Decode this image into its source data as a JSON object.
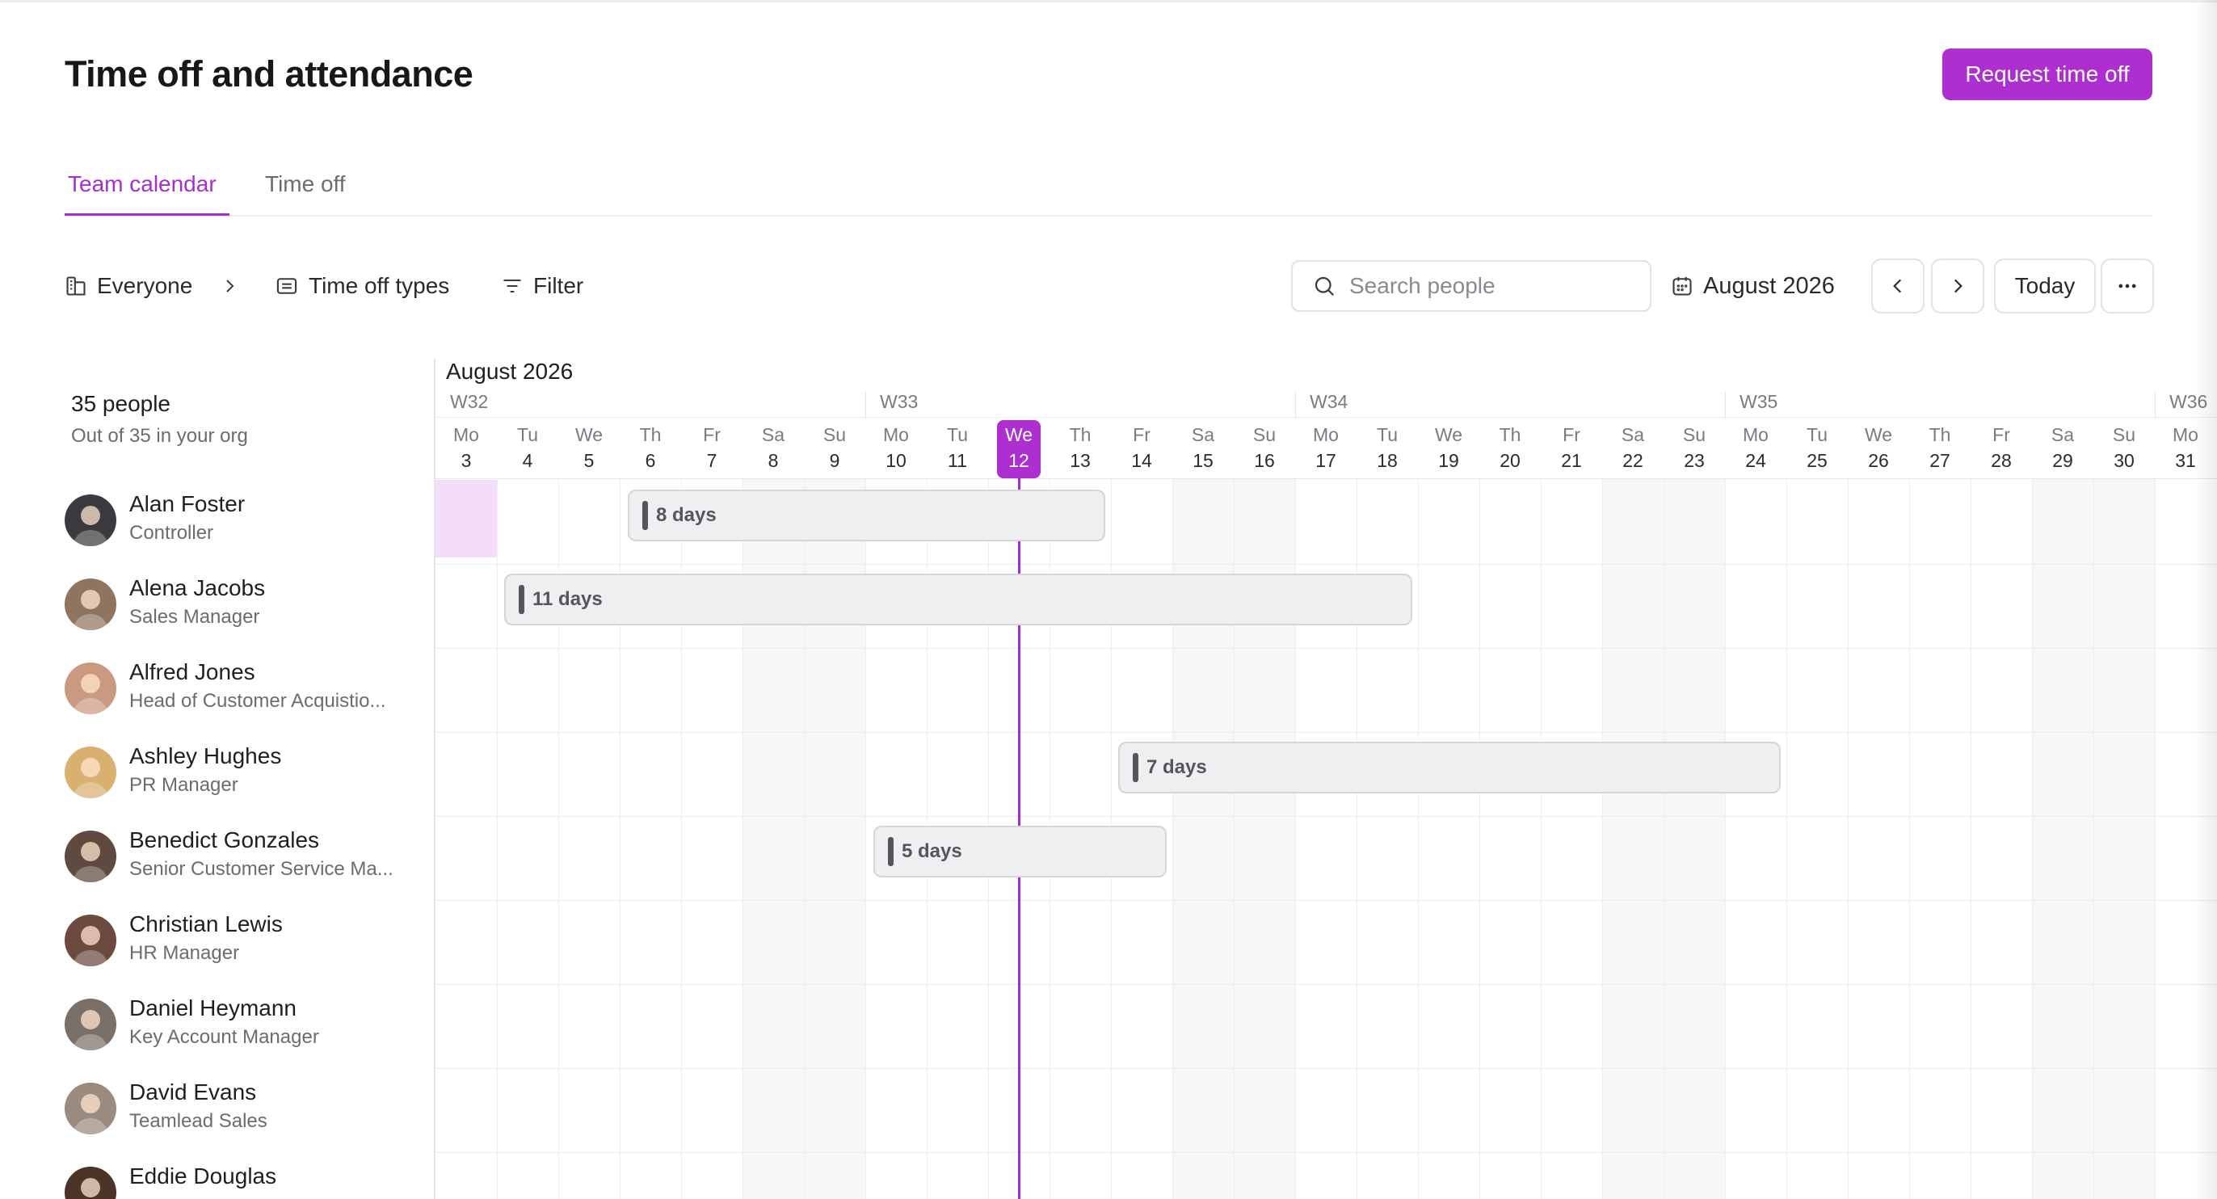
{
  "header": {
    "title": "Time off and attendance",
    "request_button": "Request time off"
  },
  "tabs": [
    {
      "label": "Team calendar",
      "active": true
    },
    {
      "label": "Time off",
      "active": false
    }
  ],
  "toolbar": {
    "group_label": "Everyone",
    "types_label": "Time off types",
    "filter_label": "Filter",
    "search_placeholder": "Search people",
    "month_label": "August 2026",
    "today_label": "Today"
  },
  "summary": {
    "count": "35 people",
    "sub": "Out of 35 in your org"
  },
  "calendar": {
    "month": "August 2026",
    "weeks": [
      "W32",
      "W33",
      "W34",
      "W35",
      "W36"
    ],
    "days": [
      {
        "name": "Mo",
        "num": "3"
      },
      {
        "name": "Tu",
        "num": "4"
      },
      {
        "name": "We",
        "num": "5"
      },
      {
        "name": "Th",
        "num": "6"
      },
      {
        "name": "Fr",
        "num": "7"
      },
      {
        "name": "Sa",
        "num": "8"
      },
      {
        "name": "Su",
        "num": "9"
      },
      {
        "name": "Mo",
        "num": "10"
      },
      {
        "name": "Tu",
        "num": "11"
      },
      {
        "name": "We",
        "num": "12"
      },
      {
        "name": "Th",
        "num": "13"
      },
      {
        "name": "Fr",
        "num": "14"
      },
      {
        "name": "Sa",
        "num": "15"
      },
      {
        "name": "Su",
        "num": "16"
      },
      {
        "name": "Mo",
        "num": "17"
      },
      {
        "name": "Tu",
        "num": "18"
      },
      {
        "name": "We",
        "num": "19"
      },
      {
        "name": "Th",
        "num": "20"
      },
      {
        "name": "Fr",
        "num": "21"
      },
      {
        "name": "Sa",
        "num": "22"
      },
      {
        "name": "Su",
        "num": "23"
      },
      {
        "name": "Mo",
        "num": "24"
      },
      {
        "name": "Tu",
        "num": "25"
      },
      {
        "name": "We",
        "num": "26"
      },
      {
        "name": "Th",
        "num": "27"
      },
      {
        "name": "Fr",
        "num": "28"
      },
      {
        "name": "Sa",
        "num": "29"
      },
      {
        "name": "Su",
        "num": "30"
      },
      {
        "name": "Mo",
        "num": "31"
      }
    ],
    "today": "12"
  },
  "people": [
    {
      "name": "Alan Foster",
      "role": "Controller",
      "avatar_color": "#3b3b3f"
    },
    {
      "name": "Alena Jacobs",
      "role": "Sales Manager",
      "avatar_color": "#8f7560"
    },
    {
      "name": "Alfred Jones",
      "role": "Head of Customer Acquistio...",
      "avatar_color": "#c99a80"
    },
    {
      "name": "Ashley Hughes",
      "role": "PR Manager",
      "avatar_color": "#d9b070"
    },
    {
      "name": "Benedict Gonzales",
      "role": "Senior Customer Service Ma...",
      "avatar_color": "#5e4a3e"
    },
    {
      "name": "Christian Lewis",
      "role": "HR Manager",
      "avatar_color": "#6b4a40"
    },
    {
      "name": "Daniel Heymann",
      "role": "Key Account Manager",
      "avatar_color": "#7a7068"
    },
    {
      "name": "David Evans",
      "role": "Teamlead Sales",
      "avatar_color": "#9a8a80"
    },
    {
      "name": "Eddie Douglas",
      "role": "",
      "avatar_color": "#4a3428"
    }
  ],
  "absences": [
    {
      "row": 0,
      "label": "8 days"
    },
    {
      "row": 1,
      "label": "11 days"
    },
    {
      "row": 3,
      "label": "7 days"
    },
    {
      "row": 4,
      "label": "5 days"
    }
  ],
  "colors": {
    "accent": "#ad2fd0",
    "highlight": "#f4ddfb"
  }
}
